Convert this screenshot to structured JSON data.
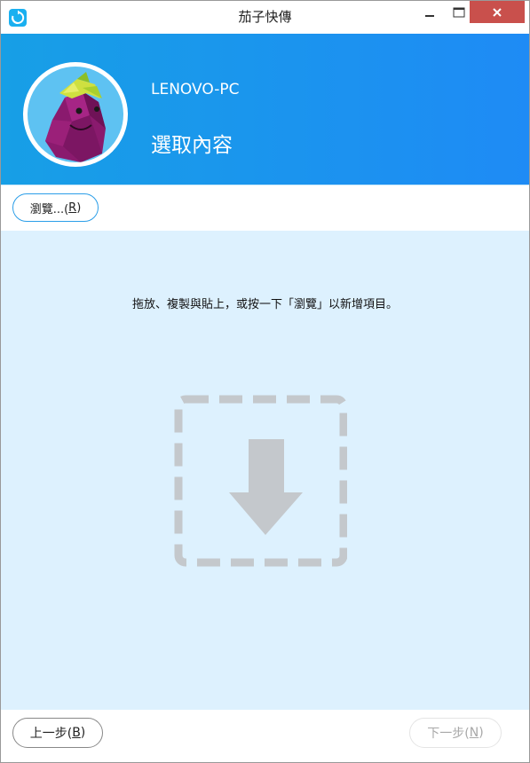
{
  "window": {
    "title": "茄子快傳",
    "app_icon": "eggplant-app-icon",
    "controls": {
      "minimize_icon": "minimize-icon",
      "maximize_icon": "maximize-icon",
      "close_icon": "close-icon"
    }
  },
  "header": {
    "device_name": "LENOVO-PC",
    "title": "選取內容",
    "avatar": "eggplant-avatar"
  },
  "toolbar": {
    "browse_label": "瀏覽...(",
    "browse_key": "R",
    "browse_suffix": ")"
  },
  "drop_area": {
    "instruction": "拖放、複製與貼上，或按一下「瀏覽」以新增項目。",
    "icon": "drop-download-icon"
  },
  "footer": {
    "prev_label": "上一步(",
    "prev_key": "B",
    "prev_suffix": ")",
    "next_label": "下一步(",
    "next_key": "N",
    "next_suffix": ")"
  },
  "colors": {
    "header_gradient_start": "#179fe6",
    "header_gradient_end": "#1e8bf5",
    "drop_area_bg": "#ddf1fe",
    "close_button": "#c9504c",
    "accent_border": "#2b9ee8"
  }
}
